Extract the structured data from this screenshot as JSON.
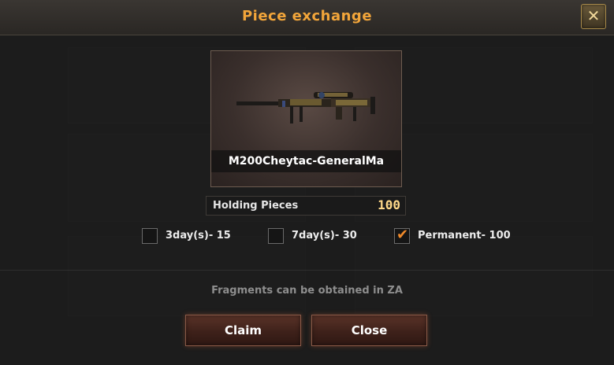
{
  "dialog": {
    "title": "Piece exchange",
    "close_icon": "close-icon"
  },
  "item": {
    "name": "M200Cheytac-GeneralMa",
    "image": "sniper-rifle-image"
  },
  "holding": {
    "label": "Holding Pieces",
    "value": "100"
  },
  "options": [
    {
      "label": "3day(s)- 15",
      "checked": false
    },
    {
      "label": "7day(s)- 30",
      "checked": false
    },
    {
      "label": "Permanent- 100",
      "checked": true
    }
  ],
  "hint": "Fragments can be obtained in ZA",
  "buttons": {
    "claim": "Claim",
    "close": "Close"
  },
  "colors": {
    "title": "#f2a53a",
    "check": "#f08a2a"
  }
}
